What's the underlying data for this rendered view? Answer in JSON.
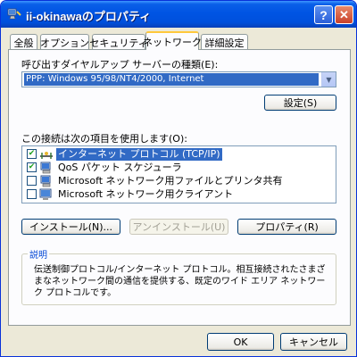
{
  "window": {
    "title": "ii-okinawaのプロパティ",
    "help_label": "?",
    "close_label": "✕"
  },
  "tabs": [
    {
      "label": "全般",
      "active": false
    },
    {
      "label": "オプション",
      "active": false
    },
    {
      "label": "セキュリティ",
      "active": false
    },
    {
      "label": "ネットワーク",
      "active": true
    },
    {
      "label": "詳細設定",
      "active": false
    }
  ],
  "dialup": {
    "label": "呼び出すダイヤルアップ サーバーの種類(E):",
    "selected_value": "PPP: Windows 95/98/NT4/2000, Internet",
    "settings_button": "設定(S)"
  },
  "components": {
    "label": "この接続は次の項目を使用します(O):",
    "items": [
      {
        "label": "インターネット プロトコル (TCP/IP)",
        "checked": true,
        "selected": true,
        "icon": "protocol-icon"
      },
      {
        "label": "QoS パケット スケジューラ",
        "checked": true,
        "selected": false,
        "icon": "service-icon"
      },
      {
        "label": "Microsoft ネットワーク用ファイルとプリンタ共有",
        "checked": false,
        "selected": false,
        "icon": "service-icon"
      },
      {
        "label": "Microsoft ネットワーク用クライアント",
        "checked": false,
        "selected": false,
        "icon": "client-icon"
      }
    ],
    "install_button": "インストール(N)...",
    "uninstall_button": "アンインストール(U)",
    "properties_button": "プロパティ(R)"
  },
  "description": {
    "title": "説明",
    "text": "伝送制御プロトコル/インターネット プロトコル。相互接続されたさまざまなネットワーク間の通信を提供する、既定のワイド エリア ネットワーク プロトコルです。"
  },
  "footer": {
    "ok_button": "OK",
    "cancel_button": "キャンセル"
  },
  "colors": {
    "titlebar": "#0054e3",
    "selection": "#316ac5",
    "dialog_bg": "#ece9d8",
    "group_title": "#0046d5"
  }
}
